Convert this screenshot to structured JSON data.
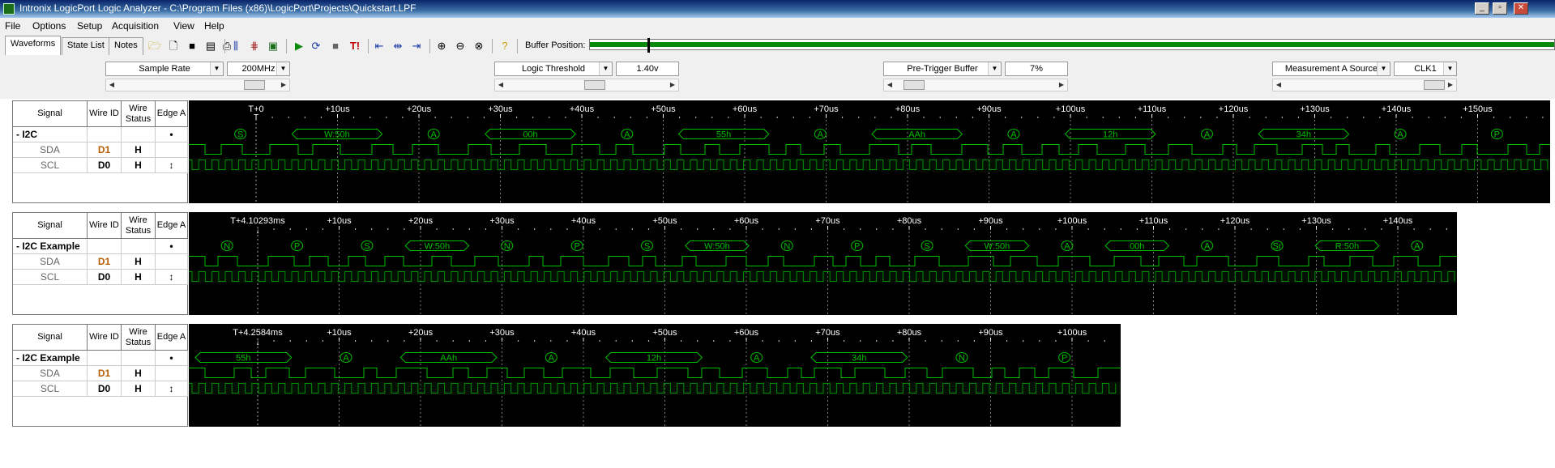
{
  "app": {
    "title": "Intronix LogicPort Logic Analyzer - C:\\Program Files (x86)\\LogicPort\\Projects\\Quickstart.LPF"
  },
  "menu": [
    "File",
    "Options",
    "Setup",
    "Acquisition",
    "View",
    "Help"
  ],
  "tabs": [
    "Waveforms",
    "State List",
    "Notes"
  ],
  "toolbar": {
    "buffer_label": "Buffer Position:",
    "buffer_position": 0.06,
    "icons": [
      "open-folder-icon",
      "new-file-icon",
      "save-icon",
      "save-as-icon",
      "print-icon",
      "bars-icon",
      "cross-bars-icon",
      "monitor-icon",
      "run-icon",
      "repeat-run-icon",
      "stop-icon",
      "trigger-icon",
      "goto-start-icon",
      "goto-trigger-icon",
      "goto-end-icon",
      "zoom-in-icon",
      "zoom-out-icon",
      "zoom-fit-icon",
      "help-icon"
    ]
  },
  "settings": [
    {
      "label": "Sample Rate",
      "value": "200MHz"
    },
    {
      "label": "Logic Threshold",
      "value": "1.40v"
    },
    {
      "label": "Pre-Trigger Buffer",
      "value": "7%"
    },
    {
      "label": "Measurement A Source",
      "value": "CLK1"
    }
  ],
  "columns": {
    "signal": "Signal",
    "wire_id": "Wire ID",
    "wire_status": "Wire Status",
    "edge": "Edge A"
  },
  "panels": [
    {
      "time_ref": "T+0",
      "trigger_mark": "T",
      "ticks": [
        "+10us",
        "+20us",
        "+30us",
        "+40us",
        "+50us",
        "+60us",
        "+70us",
        "+80us",
        "+90us",
        "+100us",
        "+110us",
        "+120us",
        "+130us",
        "+140us",
        "+150us"
      ],
      "bus": {
        "name": "- I2C",
        "edge": "•"
      },
      "channels": [
        {
          "name": "SDA",
          "wire_id": "D1",
          "status": "H",
          "edge": ""
        },
        {
          "name": "SCL",
          "wire_id": "D0",
          "status": "H",
          "edge": "↕"
        }
      ],
      "decode": [
        {
          "text": "S"
        },
        {
          "text": "W:50h"
        },
        {
          "text": "A"
        },
        {
          "text": "00h"
        },
        {
          "text": "A"
        },
        {
          "text": "55h"
        },
        {
          "text": "A"
        },
        {
          "text": "AAh"
        },
        {
          "text": "A"
        },
        {
          "text": "12h"
        },
        {
          "text": "A"
        },
        {
          "text": "34h"
        },
        {
          "text": "A"
        },
        {
          "text": "P"
        }
      ]
    },
    {
      "time_ref": "T+4.10293ms",
      "ticks": [
        "+10us",
        "+20us",
        "+30us",
        "+40us",
        "+50us",
        "+60us",
        "+70us",
        "+80us",
        "+90us",
        "+100us",
        "+110us",
        "+120us",
        "+130us",
        "+140us"
      ],
      "bus": {
        "name": "- I2C Example",
        "edge": "•"
      },
      "channels": [
        {
          "name": "SDA",
          "wire_id": "D1",
          "status": "H",
          "edge": ""
        },
        {
          "name": "SCL",
          "wire_id": "D0",
          "status": "H",
          "edge": "↕"
        }
      ],
      "decode": [
        {
          "text": "N"
        },
        {
          "text": "P"
        },
        {
          "text": "S"
        },
        {
          "text": "W:50h"
        },
        {
          "text": "N"
        },
        {
          "text": "P"
        },
        {
          "text": "S"
        },
        {
          "text": "W:50h"
        },
        {
          "text": "N"
        },
        {
          "text": "P"
        },
        {
          "text": "S"
        },
        {
          "text": "W:50h"
        },
        {
          "text": "A"
        },
        {
          "text": "00h"
        },
        {
          "text": "A"
        },
        {
          "text": "Sr"
        },
        {
          "text": "R:50h"
        },
        {
          "text": "A"
        }
      ]
    },
    {
      "time_ref": "T+4.2584ms",
      "ticks": [
        "+10us",
        "+20us",
        "+30us",
        "+40us",
        "+50us",
        "+60us",
        "+70us",
        "+80us",
        "+90us",
        "+100us"
      ],
      "bus": {
        "name": "- I2C Example",
        "edge": "•"
      },
      "channels": [
        {
          "name": "SDA",
          "wire_id": "D1",
          "status": "H",
          "edge": ""
        },
        {
          "name": "SCL",
          "wire_id": "D0",
          "status": "H",
          "edge": "↕"
        }
      ],
      "decode": [
        {
          "text": "55h"
        },
        {
          "text": "A"
        },
        {
          "text": "AAh"
        },
        {
          "text": "A"
        },
        {
          "text": "12h"
        },
        {
          "text": "A"
        },
        {
          "text": "34h"
        },
        {
          "text": "N"
        },
        {
          "text": "P"
        }
      ]
    }
  ],
  "colors": {
    "wave": "#00c000",
    "grid": "#808080",
    "bg": "#000000",
    "wire_id": "#b85c00"
  }
}
